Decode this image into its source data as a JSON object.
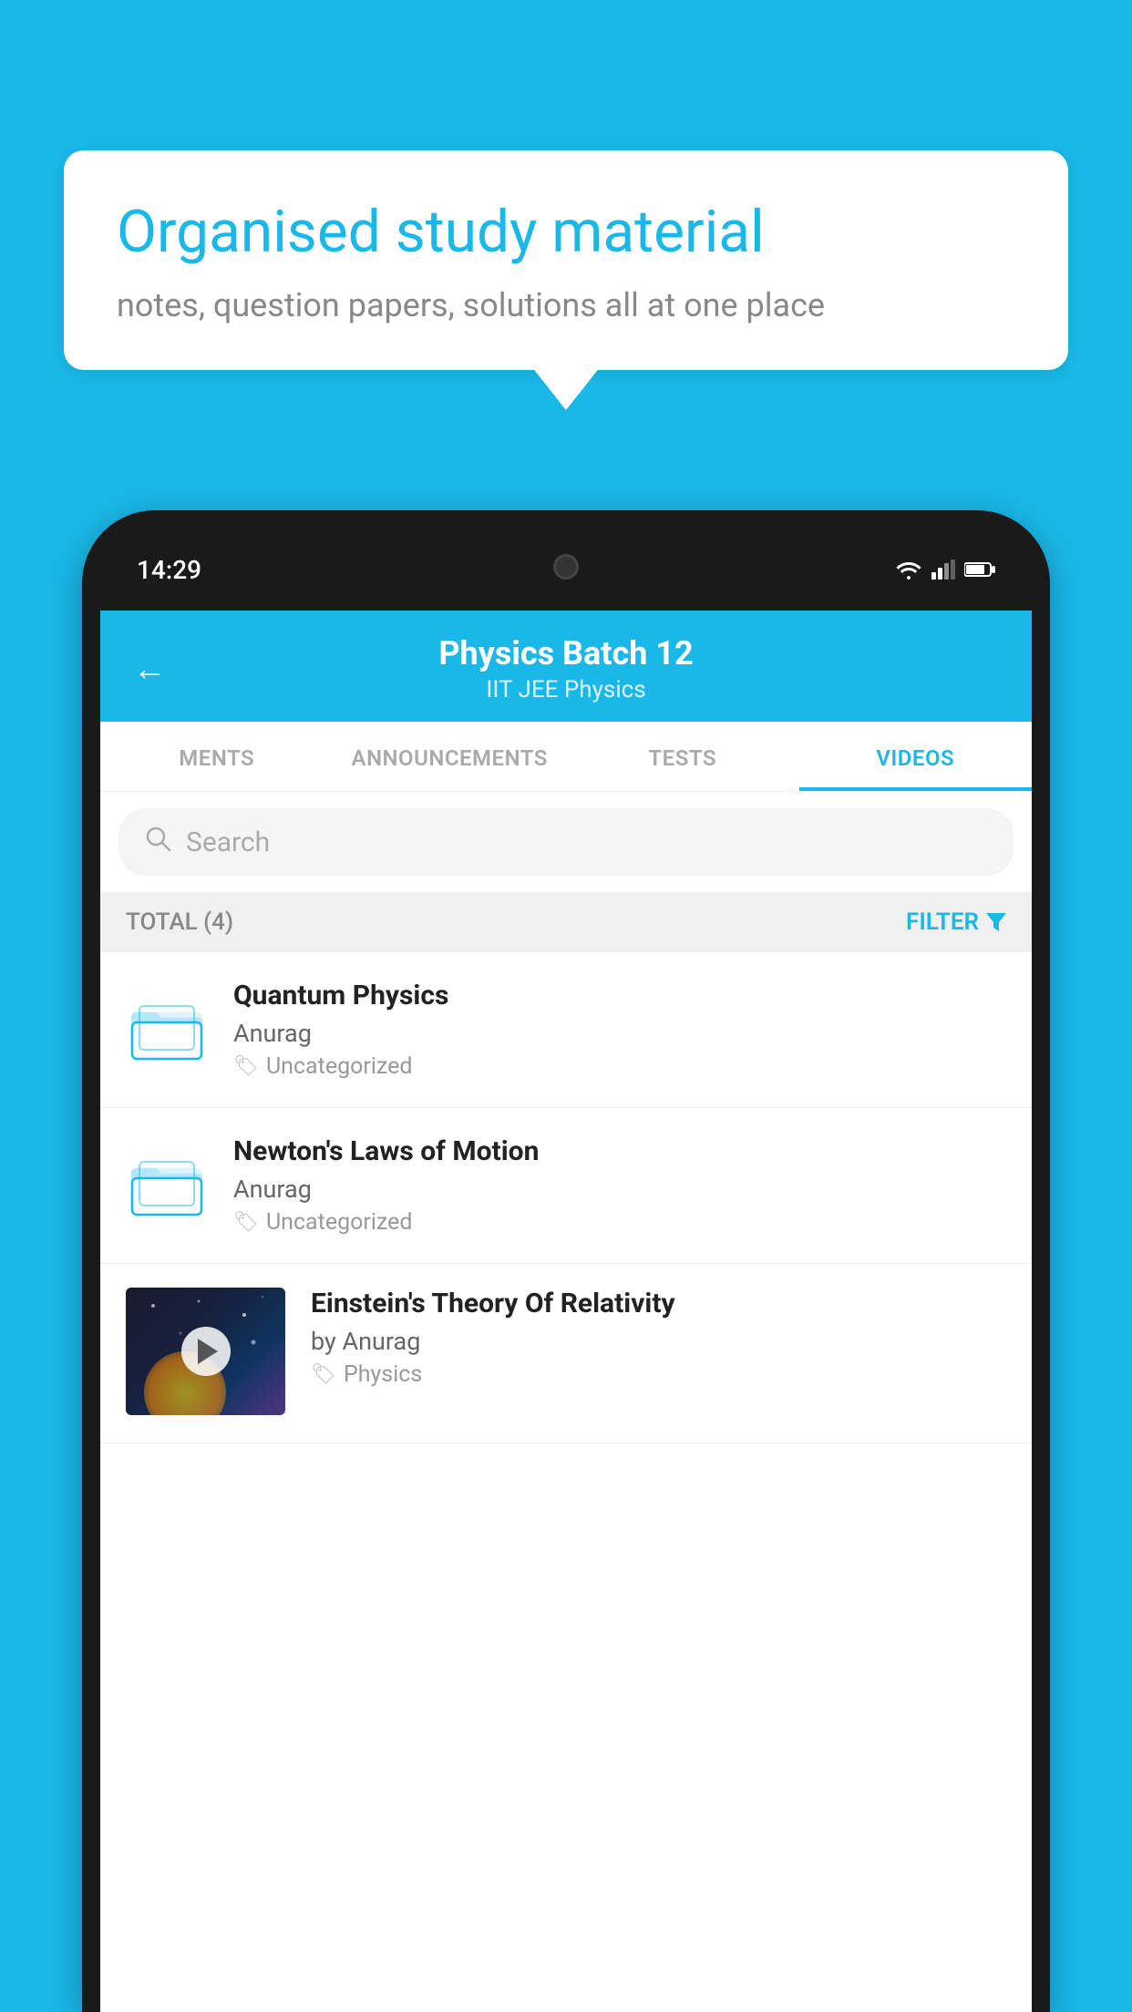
{
  "background_color": "#1ab8e8",
  "speech_bubble": {
    "title": "Organised study material",
    "subtitle": "notes, question papers, solutions all at one place"
  },
  "phone": {
    "time": "14:29",
    "status_icons": [
      "wifi",
      "signal",
      "battery"
    ]
  },
  "app": {
    "header": {
      "title": "Physics Batch 12",
      "subtitle": "IIT JEE   Physics",
      "back_label": "←"
    },
    "tabs": [
      {
        "label": "MENTS",
        "active": false
      },
      {
        "label": "ANNOUNCEMENTS",
        "active": false
      },
      {
        "label": "TESTS",
        "active": false
      },
      {
        "label": "VIDEOS",
        "active": true
      }
    ],
    "search": {
      "placeholder": "Search"
    },
    "filter_bar": {
      "total_label": "TOTAL (4)",
      "filter_label": "FILTER"
    },
    "videos": [
      {
        "id": 1,
        "title": "Quantum Physics",
        "author": "Anurag",
        "tag": "Uncategorized",
        "type": "folder"
      },
      {
        "id": 2,
        "title": "Newton's Laws of Motion",
        "author": "Anurag",
        "tag": "Uncategorized",
        "type": "folder"
      },
      {
        "id": 3,
        "title": "Einstein's Theory Of Relativity",
        "author": "by Anurag",
        "tag": "Physics",
        "type": "video"
      }
    ]
  }
}
